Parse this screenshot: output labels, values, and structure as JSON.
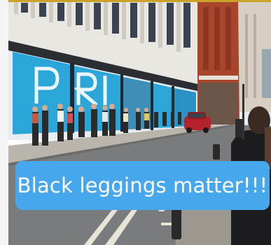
{
  "caption": {
    "text": "Black leggings matter!!!",
    "bg_color": "#46a7ec",
    "text_color": "#ffffff"
  },
  "storefront": {
    "sign_letters": "PRIM"
  },
  "colors": {
    "building_facade": "#e9e7e2",
    "window_panels": "#2aa6d8",
    "road": "#7a7b7d",
    "sidewalk": "#b9b5ad",
    "red_car": "#b4232b",
    "brick_building": "#a8462c"
  }
}
